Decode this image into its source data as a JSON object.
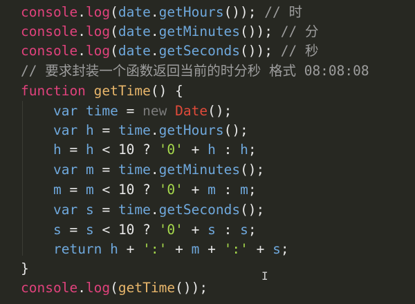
{
  "lines": [
    {
      "t": [
        [
          "console",
          "pink"
        ],
        [
          ".",
          "white"
        ],
        [
          "log",
          "pink"
        ],
        [
          "(",
          "white"
        ],
        [
          "date",
          "blue"
        ],
        [
          ".",
          "white"
        ],
        [
          "getHours",
          "blue"
        ],
        [
          "()); ",
          "white"
        ],
        [
          "// 时",
          "gray"
        ]
      ]
    },
    {
      "t": [
        [
          "console",
          "pink"
        ],
        [
          ".",
          "white"
        ],
        [
          "log",
          "pink"
        ],
        [
          "(",
          "white"
        ],
        [
          "date",
          "blue"
        ],
        [
          ".",
          "white"
        ],
        [
          "getMinutes",
          "blue"
        ],
        [
          "()); ",
          "white"
        ],
        [
          "// 分",
          "gray"
        ]
      ]
    },
    {
      "t": [
        [
          "console",
          "pink"
        ],
        [
          ".",
          "white"
        ],
        [
          "log",
          "pink"
        ],
        [
          "(",
          "white"
        ],
        [
          "date",
          "blue"
        ],
        [
          ".",
          "white"
        ],
        [
          "getSeconds",
          "blue"
        ],
        [
          "()); ",
          "white"
        ],
        [
          "// 秒",
          "gray"
        ]
      ]
    },
    {
      "t": [
        [
          "// 要求封装一个函数返回当前的时分秒 格式 08:08:08",
          "gray"
        ]
      ]
    },
    {
      "t": [
        [
          "function",
          "pink"
        ],
        [
          " ",
          "white"
        ],
        [
          "getTime",
          "gold"
        ],
        [
          "() {",
          "white"
        ]
      ]
    },
    {
      "t": [
        [
          "    ",
          "white"
        ],
        [
          "var",
          "blue"
        ],
        [
          " ",
          "white"
        ],
        [
          "time",
          "blue"
        ],
        [
          " = ",
          "white"
        ],
        [
          "new",
          "dim"
        ],
        [
          " ",
          "white"
        ],
        [
          "Date",
          "red"
        ],
        [
          "();",
          "white"
        ]
      ]
    },
    {
      "t": [
        [
          "    ",
          "white"
        ],
        [
          "var",
          "blue"
        ],
        [
          " ",
          "white"
        ],
        [
          "h",
          "blue"
        ],
        [
          " = ",
          "white"
        ],
        [
          "time",
          "blue"
        ],
        [
          ".",
          "white"
        ],
        [
          "getHours",
          "blue"
        ],
        [
          "();",
          "white"
        ]
      ]
    },
    {
      "t": [
        [
          "    ",
          "white"
        ],
        [
          "h",
          "blue"
        ],
        [
          " = ",
          "white"
        ],
        [
          "h",
          "blue"
        ],
        [
          " < ",
          "white"
        ],
        [
          "10",
          "white"
        ],
        [
          " ? ",
          "white"
        ],
        [
          "'0'",
          "green"
        ],
        [
          " + ",
          "white"
        ],
        [
          "h",
          "blue"
        ],
        [
          " : ",
          "white"
        ],
        [
          "h",
          "blue"
        ],
        [
          ";",
          "white"
        ]
      ]
    },
    {
      "t": [
        [
          "    ",
          "white"
        ],
        [
          "var",
          "blue"
        ],
        [
          " ",
          "white"
        ],
        [
          "m",
          "blue"
        ],
        [
          " = ",
          "white"
        ],
        [
          "time",
          "blue"
        ],
        [
          ".",
          "white"
        ],
        [
          "getMinutes",
          "blue"
        ],
        [
          "();",
          "white"
        ]
      ]
    },
    {
      "t": [
        [
          "    ",
          "white"
        ],
        [
          "m",
          "blue"
        ],
        [
          " = ",
          "white"
        ],
        [
          "m",
          "blue"
        ],
        [
          " < ",
          "white"
        ],
        [
          "10",
          "white"
        ],
        [
          " ? ",
          "white"
        ],
        [
          "'0'",
          "green"
        ],
        [
          " + ",
          "white"
        ],
        [
          "m",
          "blue"
        ],
        [
          " : ",
          "white"
        ],
        [
          "m",
          "blue"
        ],
        [
          ";",
          "white"
        ]
      ]
    },
    {
      "t": [
        [
          "    ",
          "white"
        ],
        [
          "var",
          "blue"
        ],
        [
          " ",
          "white"
        ],
        [
          "s",
          "blue"
        ],
        [
          " = ",
          "white"
        ],
        [
          "time",
          "blue"
        ],
        [
          ".",
          "white"
        ],
        [
          "getSeconds",
          "blue"
        ],
        [
          "();",
          "white"
        ]
      ]
    },
    {
      "t": [
        [
          "    ",
          "white"
        ],
        [
          "s",
          "blue"
        ],
        [
          " = ",
          "white"
        ],
        [
          "s",
          "blue"
        ],
        [
          " < ",
          "white"
        ],
        [
          "10",
          "white"
        ],
        [
          " ? ",
          "white"
        ],
        [
          "'0'",
          "green"
        ],
        [
          " + ",
          "white"
        ],
        [
          "s",
          "blue"
        ],
        [
          " : ",
          "white"
        ],
        [
          "s",
          "blue"
        ],
        [
          ";",
          "white"
        ]
      ]
    },
    {
      "t": [
        [
          "    ",
          "white"
        ],
        [
          "return",
          "blue"
        ],
        [
          " ",
          "white"
        ],
        [
          "h",
          "blue"
        ],
        [
          " + ",
          "white"
        ],
        [
          "':'",
          "green"
        ],
        [
          " + ",
          "white"
        ],
        [
          "m",
          "blue"
        ],
        [
          " + ",
          "white"
        ],
        [
          "':'",
          "green"
        ],
        [
          " + ",
          "white"
        ],
        [
          "s",
          "blue"
        ],
        [
          ";",
          "white"
        ]
      ]
    },
    {
      "t": [
        [
          "}",
          "white"
        ]
      ]
    },
    {
      "t": [
        [
          "console",
          "pink"
        ],
        [
          ".",
          "white"
        ],
        [
          "log",
          "pink"
        ],
        [
          "(",
          "white"
        ],
        [
          "getTime",
          "gold"
        ],
        [
          "());",
          "white"
        ]
      ]
    }
  ],
  "cursor_glyph": "I",
  "colors": {
    "background": "#272822",
    "pink": "#e0427c",
    "blue": "#6fa8dc",
    "gold": "#e8b66b",
    "white": "#e8e8e8",
    "gray": "#9d9d9d",
    "dim": "#7c7c7c",
    "red": "#e04a3a",
    "green": "#a6d94c"
  }
}
